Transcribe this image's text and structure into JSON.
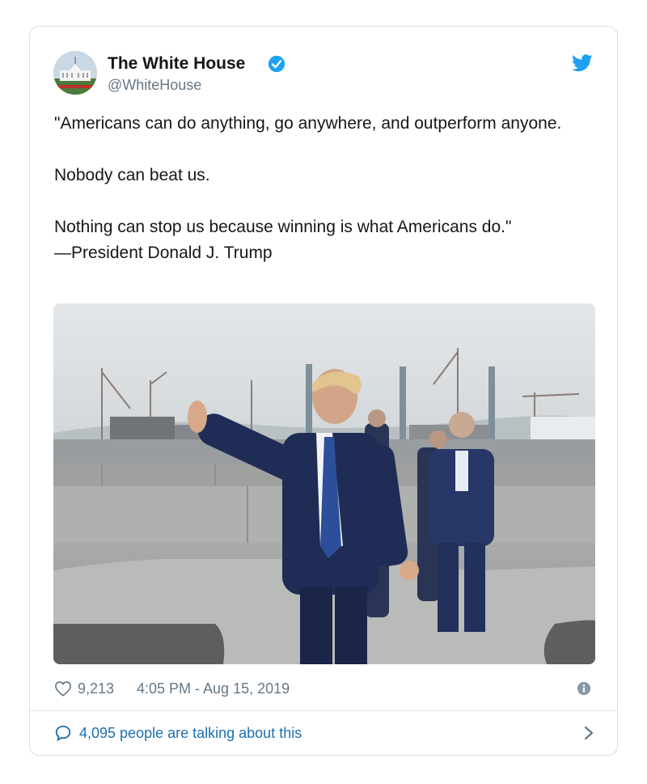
{
  "tweet": {
    "author": {
      "name": "The White House",
      "handle": "@WhiteHouse",
      "avatar_icon": "white-house-avatar",
      "verified_icon": "verified-badge-icon"
    },
    "brand_icon": "twitter-bird-icon",
    "text": "\"Americans can do anything, go anywhere, and outperform anyone.\n\nNobody can beat us.\n\nNothing can stop us because winning is what Americans do.\"\n—President Donald J. Trump",
    "media": {
      "type": "photo"
    },
    "likes": "9,213",
    "timestamp": "4:05 PM - Aug 15, 2019",
    "talking": "4,095 people are talking about this"
  },
  "colors": {
    "brand": "#1da1f2",
    "link": "#1b6fae",
    "text": "#14171a",
    "muted": "#657786",
    "border": "#d8dee3"
  },
  "icons": {
    "like": "heart-icon",
    "info": "info-icon",
    "reply": "speech-bubble-icon",
    "more": "chevron-right-icon"
  }
}
